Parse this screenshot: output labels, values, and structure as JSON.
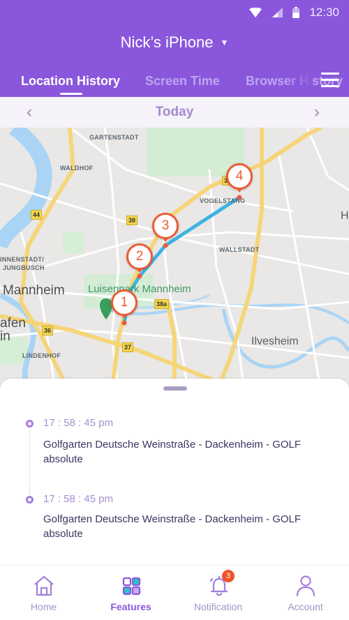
{
  "status_bar": {
    "time": "12:30",
    "icons": [
      "wifi-icon",
      "signal-icon",
      "battery-icon"
    ]
  },
  "header": {
    "device_name": "Nick’s iPhone",
    "device_caret": "▼",
    "tabs": [
      {
        "label": "Location History",
        "active": true
      },
      {
        "label": "Screen Time",
        "active": false
      },
      {
        "label": "Browser History",
        "active": false
      }
    ],
    "menu_icon": "hamburger-menu-icon"
  },
  "date_nav": {
    "prev": "‹",
    "label": "Today",
    "next": "›"
  },
  "map": {
    "labels": {
      "gartenstadt": "GARTENSTADT",
      "waldhof": "WALDHOF",
      "vogelstang": "VOGELSTANG",
      "wallstadt": "WALLSTADT",
      "innenstadt1": "INNENSTADT/",
      "innenstadt2": "JUNGBUSCH",
      "mannheim": "Mannheim",
      "luisenpark": "Luisenpark Mannheim",
      "afen": "afen",
      "in": "in",
      "lindenhof": "LINDENHOF",
      "ilvesheim": "Ilvesheim",
      "h": "H"
    },
    "shields": {
      "a": "44",
      "b": "38",
      "c": "38a",
      "d": "36",
      "e": "37",
      "f": "3"
    },
    "route_color": "#3fb2e4",
    "marker_color": "#ec5b35",
    "markers": [
      {
        "label": "1"
      },
      {
        "label": "2"
      },
      {
        "label": "3"
      },
      {
        "label": "4"
      }
    ]
  },
  "timeline": {
    "entries": [
      {
        "time": "17 : 58 : 45 pm",
        "place": "Golfgarten Deutsche Weinstraße - Dackenheim - GOLF absolute"
      },
      {
        "time": "17 : 58 : 45 pm",
        "place": "Golfgarten Deutsche Weinstraße - Dackenheim - GOLF absolute"
      }
    ]
  },
  "bottom_nav": {
    "items": [
      {
        "label": "Home",
        "icon": "home-icon",
        "active": false
      },
      {
        "label": "Features",
        "icon": "features-grid-icon",
        "active": true
      },
      {
        "label": "Notification",
        "icon": "bell-icon",
        "active": false,
        "badge": "3"
      },
      {
        "label": "Account",
        "icon": "user-icon",
        "active": false
      }
    ]
  },
  "colors": {
    "primary": "#8a57dc",
    "accent_teal": "#2fc1c4",
    "badge": "#f0522a"
  }
}
